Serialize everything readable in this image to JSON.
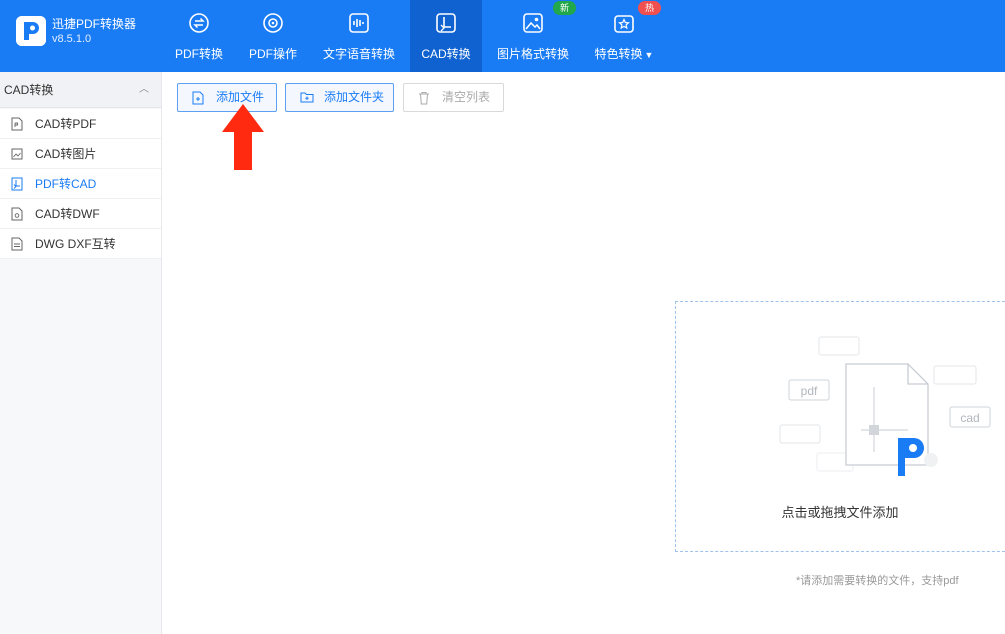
{
  "app": {
    "name": "迅捷PDF转换器",
    "version": "v8.5.1.0"
  },
  "nav": {
    "tabs": [
      {
        "label": "PDF转换",
        "icon": "pdf-convert-icon"
      },
      {
        "label": "PDF操作",
        "icon": "pdf-operate-icon"
      },
      {
        "label": "文字语音转换",
        "icon": "voice-wave-icon"
      },
      {
        "label": "CAD转换",
        "icon": "cad-convert-icon",
        "active": true
      },
      {
        "label": "图片格式转换",
        "icon": "image-icon",
        "badge": "新"
      },
      {
        "label": "特色转换",
        "icon": "star-badge-icon",
        "badge": "热",
        "has_dropdown": true
      }
    ]
  },
  "sidebar": {
    "title": "CAD转换",
    "items": [
      {
        "label": "CAD转PDF",
        "icon": "pdf-file-icon"
      },
      {
        "label": "CAD转图片",
        "icon": "image-file-icon"
      },
      {
        "label": "PDF转CAD",
        "icon": "cad-file-icon",
        "active": true
      },
      {
        "label": "CAD转DWF",
        "icon": "dwf-file-icon"
      },
      {
        "label": "DWG DXF互转",
        "icon": "dwg-file-icon"
      }
    ]
  },
  "toolbar": {
    "add_file": "添加文件",
    "add_folder": "添加文件夹",
    "clear_list": "清空列表"
  },
  "dropzone": {
    "text": "点击或拖拽文件添加",
    "formats": [
      "pdf",
      "cad"
    ]
  },
  "hint": "*请添加需要转换的文件，支持pdf",
  "colors": {
    "brand": "#1a7cf5",
    "new_badge": "#22a84a",
    "hot_badge": "#f05050",
    "arrow": "#ff2a10"
  }
}
